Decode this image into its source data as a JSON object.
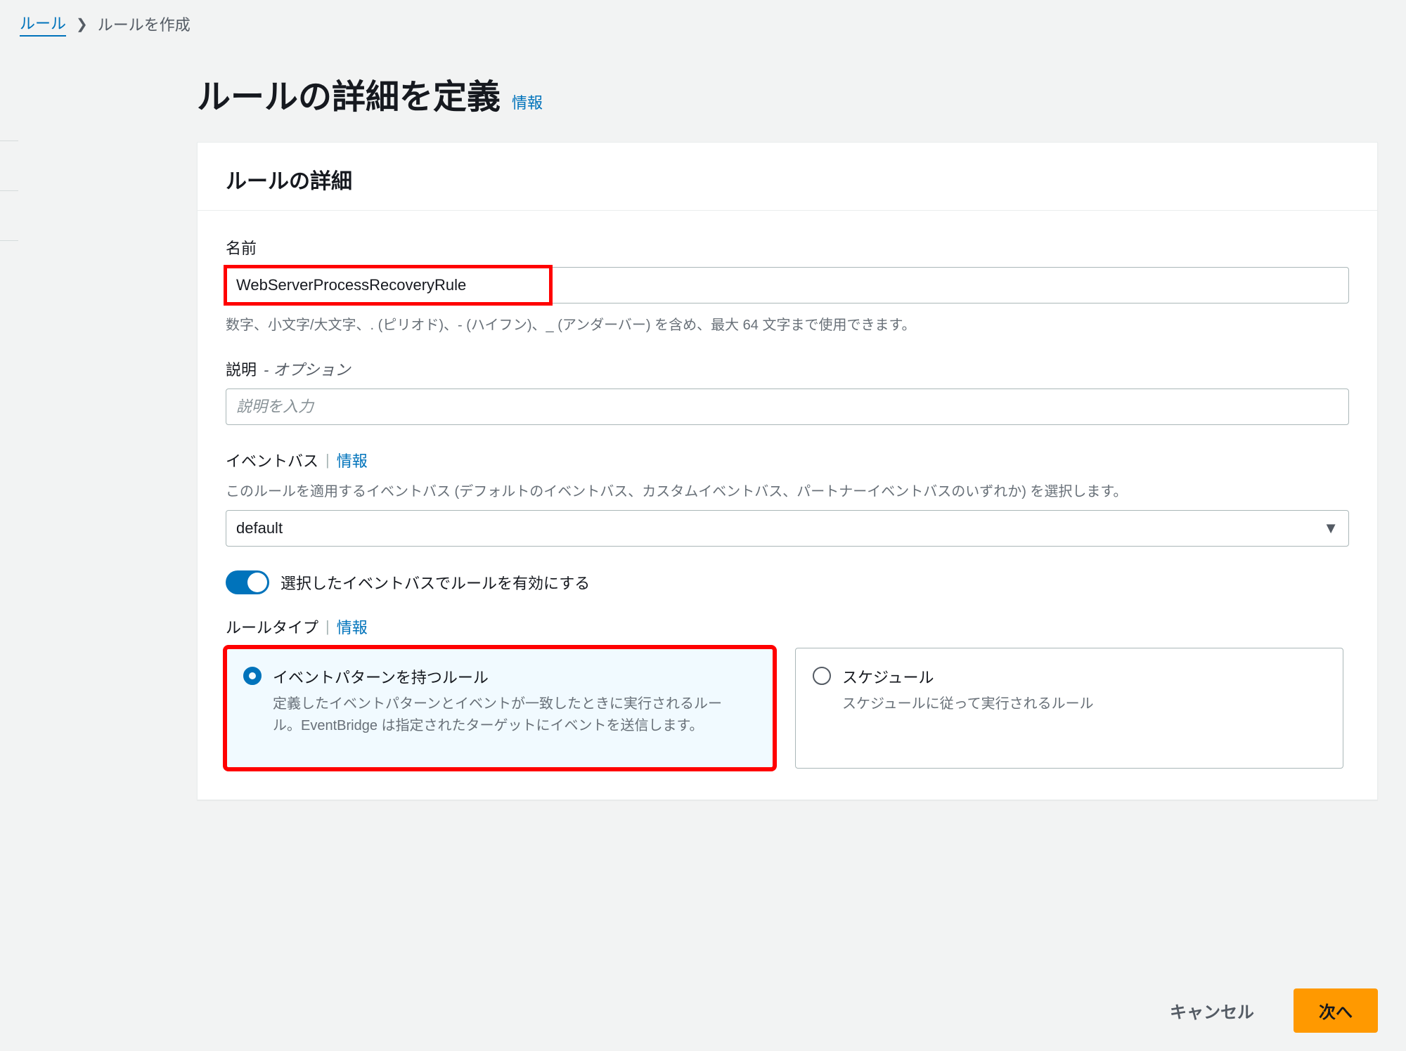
{
  "breadcrumb": {
    "root": "ルール",
    "current": "ルールを作成"
  },
  "page": {
    "title": "ルールの詳細を定義",
    "info_label": "情報"
  },
  "panel": {
    "header": "ルールの詳細"
  },
  "name": {
    "label": "名前",
    "value": "WebServerProcessRecoveryRule",
    "helper": "数字、小文字/大文字、. (ピリオド)、- (ハイフン)、_ (アンダーバー) を含め、最大 64 文字まで使用できます。"
  },
  "description": {
    "label": "説明",
    "optional": "- オプション",
    "placeholder": "説明を入力"
  },
  "event_bus": {
    "label": "イベントバス",
    "info": "情報",
    "helper": "このルールを適用するイベントバス (デフォルトのイベントバス、カスタムイベントバス、パートナーイベントバスのいずれか) を選択します。",
    "value": "default"
  },
  "enable_toggle": {
    "label": "選択したイベントバスでルールを有効にする"
  },
  "rule_type": {
    "label": "ルールタイプ",
    "info": "情報",
    "options": [
      {
        "title": "イベントパターンを持つルール",
        "desc": "定義したイベントパターンとイベントが一致したときに実行されるルール。EventBridge は指定されたターゲットにイベントを送信します。"
      },
      {
        "title": "スケジュール",
        "desc": "スケジュールに従って実行されるルール"
      }
    ]
  },
  "footer": {
    "cancel": "キャンセル",
    "next": "次へ"
  }
}
